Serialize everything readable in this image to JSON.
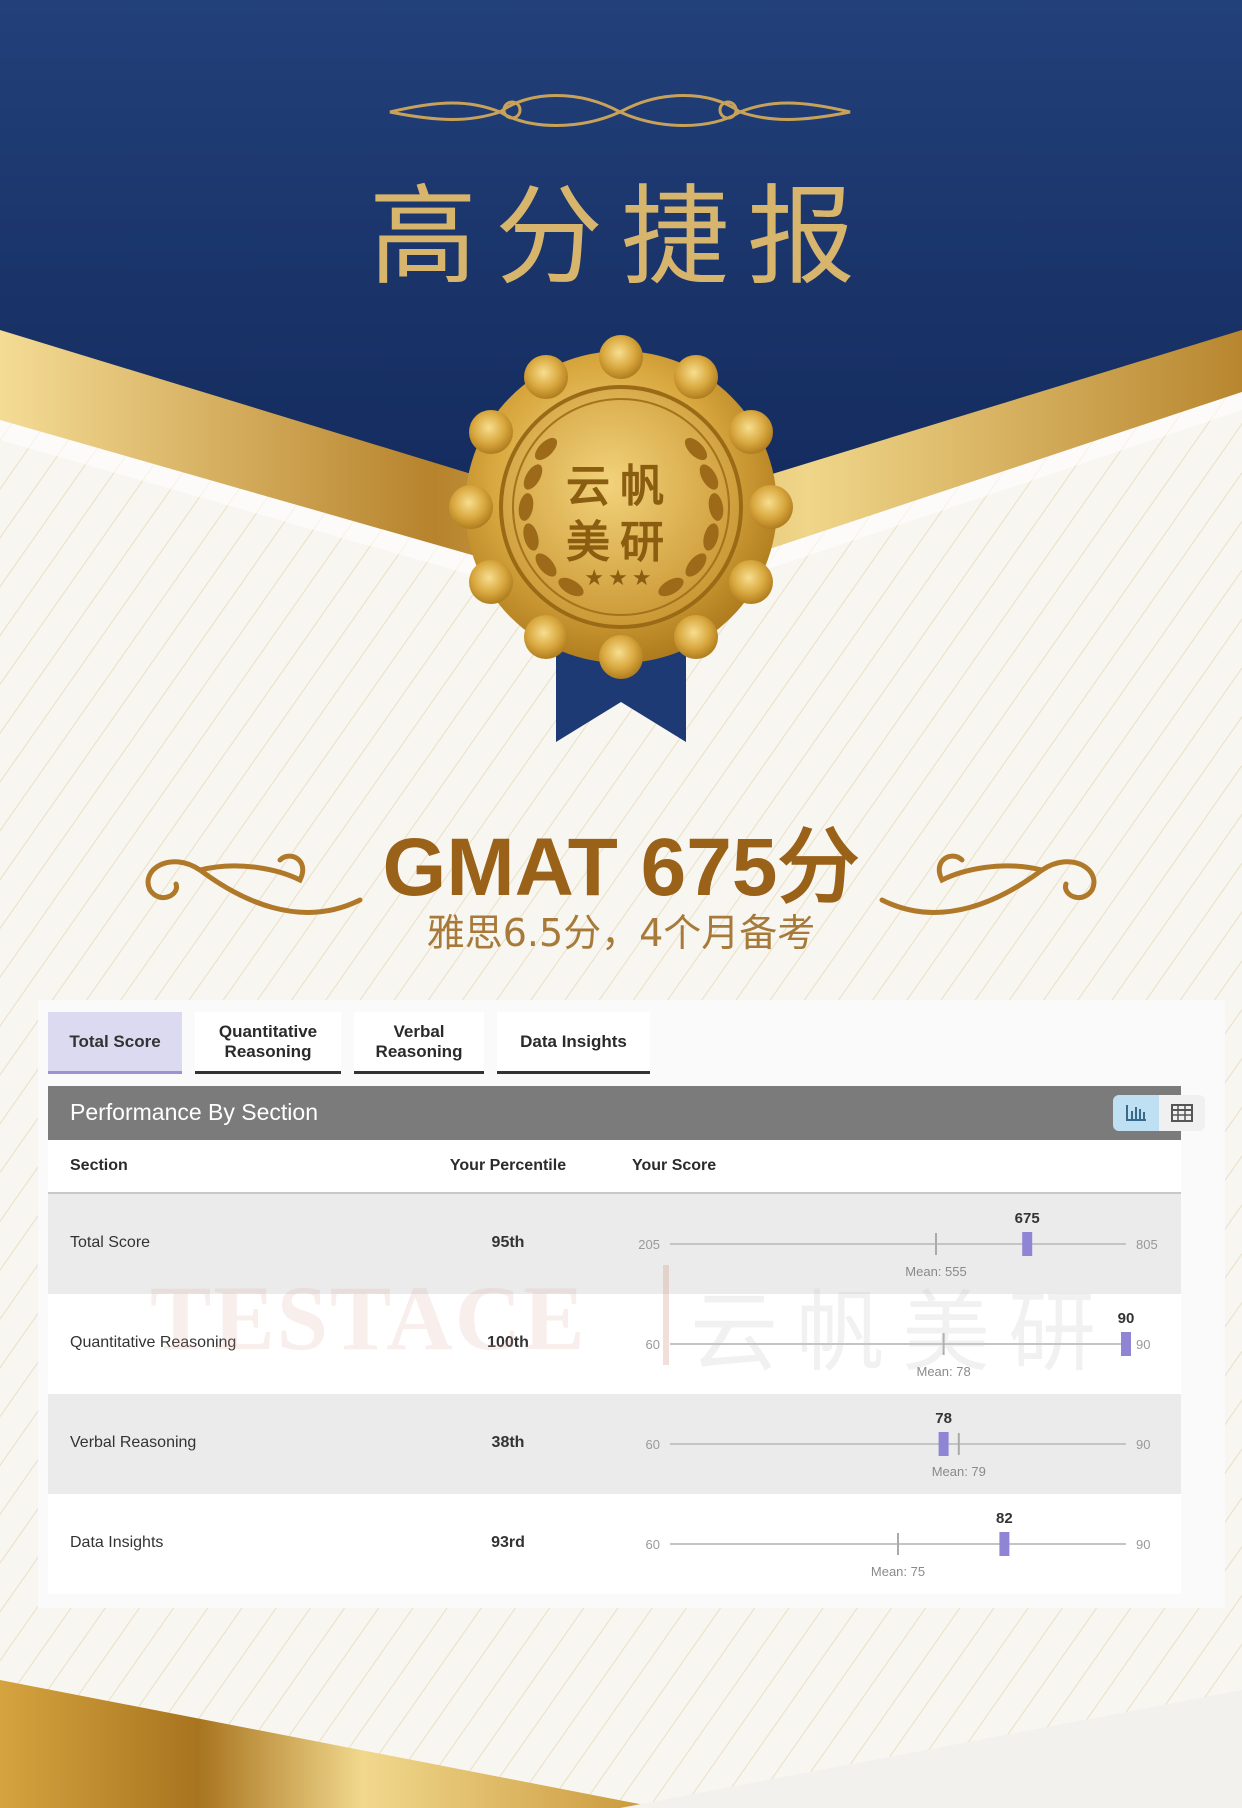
{
  "hero": {
    "title": "高分捷报",
    "medal_line1": "云帆",
    "medal_line2": "美研",
    "medal_stars": "★★★",
    "score_title": "GMAT 675分",
    "score_subtitle": "雅思6.5分，4个月备考"
  },
  "colors": {
    "navy": "#1d3a73",
    "gold": "#c99a3c",
    "accent_purple": "#8f85d4",
    "headline_brown": "#9a6219"
  },
  "watermark": {
    "latin": "TESTACE",
    "chinese": "云帆美研"
  },
  "tabs": [
    {
      "label": "Total Score",
      "active": true
    },
    {
      "label": "Quantitative\nReasoning",
      "active": false
    },
    {
      "label": "Verbal\nReasoning",
      "active": false
    },
    {
      "label": "Data Insights",
      "active": false
    }
  ],
  "panel": {
    "title": "Performance By Section",
    "chart_toggle_icon": "bar-chart-icon",
    "table_toggle_icon": "table-icon"
  },
  "columns": {
    "section": "Section",
    "percentile": "Your Percentile",
    "score": "Your Score"
  },
  "chart_data": {
    "type": "table",
    "rows": [
      {
        "section": "Total Score",
        "percentile": "95th",
        "min": 205,
        "max": 805,
        "score": 675,
        "mean": 555,
        "mean_label": "Mean: 555"
      },
      {
        "section": "Quantitative Reasoning",
        "percentile": "100th",
        "min": 60,
        "max": 90,
        "score": 90,
        "mean": 78,
        "mean_label": "Mean: 78"
      },
      {
        "section": "Verbal Reasoning",
        "percentile": "38th",
        "min": 60,
        "max": 90,
        "score": 78,
        "mean": 79,
        "mean_label": "Mean: 79"
      },
      {
        "section": "Data Insights",
        "percentile": "93rd",
        "min": 60,
        "max": 90,
        "score": 82,
        "mean": 75,
        "mean_label": "Mean: 75"
      }
    ]
  }
}
